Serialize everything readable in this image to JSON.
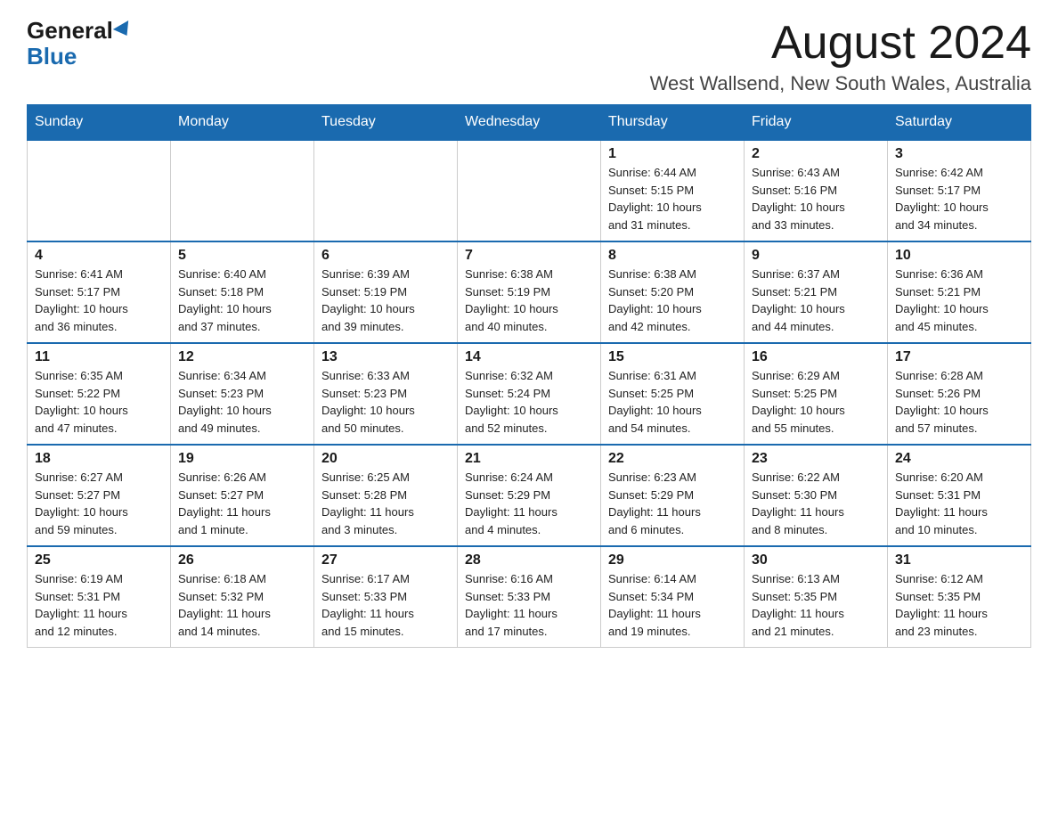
{
  "header": {
    "logo_general": "General",
    "logo_blue": "Blue",
    "month_title": "August 2024",
    "location": "West Wallsend, New South Wales, Australia"
  },
  "days_of_week": [
    "Sunday",
    "Monday",
    "Tuesday",
    "Wednesday",
    "Thursday",
    "Friday",
    "Saturday"
  ],
  "weeks": [
    [
      {
        "day": "",
        "info": ""
      },
      {
        "day": "",
        "info": ""
      },
      {
        "day": "",
        "info": ""
      },
      {
        "day": "",
        "info": ""
      },
      {
        "day": "1",
        "info": "Sunrise: 6:44 AM\nSunset: 5:15 PM\nDaylight: 10 hours\nand 31 minutes."
      },
      {
        "day": "2",
        "info": "Sunrise: 6:43 AM\nSunset: 5:16 PM\nDaylight: 10 hours\nand 33 minutes."
      },
      {
        "day": "3",
        "info": "Sunrise: 6:42 AM\nSunset: 5:17 PM\nDaylight: 10 hours\nand 34 minutes."
      }
    ],
    [
      {
        "day": "4",
        "info": "Sunrise: 6:41 AM\nSunset: 5:17 PM\nDaylight: 10 hours\nand 36 minutes."
      },
      {
        "day": "5",
        "info": "Sunrise: 6:40 AM\nSunset: 5:18 PM\nDaylight: 10 hours\nand 37 minutes."
      },
      {
        "day": "6",
        "info": "Sunrise: 6:39 AM\nSunset: 5:19 PM\nDaylight: 10 hours\nand 39 minutes."
      },
      {
        "day": "7",
        "info": "Sunrise: 6:38 AM\nSunset: 5:19 PM\nDaylight: 10 hours\nand 40 minutes."
      },
      {
        "day": "8",
        "info": "Sunrise: 6:38 AM\nSunset: 5:20 PM\nDaylight: 10 hours\nand 42 minutes."
      },
      {
        "day": "9",
        "info": "Sunrise: 6:37 AM\nSunset: 5:21 PM\nDaylight: 10 hours\nand 44 minutes."
      },
      {
        "day": "10",
        "info": "Sunrise: 6:36 AM\nSunset: 5:21 PM\nDaylight: 10 hours\nand 45 minutes."
      }
    ],
    [
      {
        "day": "11",
        "info": "Sunrise: 6:35 AM\nSunset: 5:22 PM\nDaylight: 10 hours\nand 47 minutes."
      },
      {
        "day": "12",
        "info": "Sunrise: 6:34 AM\nSunset: 5:23 PM\nDaylight: 10 hours\nand 49 minutes."
      },
      {
        "day": "13",
        "info": "Sunrise: 6:33 AM\nSunset: 5:23 PM\nDaylight: 10 hours\nand 50 minutes."
      },
      {
        "day": "14",
        "info": "Sunrise: 6:32 AM\nSunset: 5:24 PM\nDaylight: 10 hours\nand 52 minutes."
      },
      {
        "day": "15",
        "info": "Sunrise: 6:31 AM\nSunset: 5:25 PM\nDaylight: 10 hours\nand 54 minutes."
      },
      {
        "day": "16",
        "info": "Sunrise: 6:29 AM\nSunset: 5:25 PM\nDaylight: 10 hours\nand 55 minutes."
      },
      {
        "day": "17",
        "info": "Sunrise: 6:28 AM\nSunset: 5:26 PM\nDaylight: 10 hours\nand 57 minutes."
      }
    ],
    [
      {
        "day": "18",
        "info": "Sunrise: 6:27 AM\nSunset: 5:27 PM\nDaylight: 10 hours\nand 59 minutes."
      },
      {
        "day": "19",
        "info": "Sunrise: 6:26 AM\nSunset: 5:27 PM\nDaylight: 11 hours\nand 1 minute."
      },
      {
        "day": "20",
        "info": "Sunrise: 6:25 AM\nSunset: 5:28 PM\nDaylight: 11 hours\nand 3 minutes."
      },
      {
        "day": "21",
        "info": "Sunrise: 6:24 AM\nSunset: 5:29 PM\nDaylight: 11 hours\nand 4 minutes."
      },
      {
        "day": "22",
        "info": "Sunrise: 6:23 AM\nSunset: 5:29 PM\nDaylight: 11 hours\nand 6 minutes."
      },
      {
        "day": "23",
        "info": "Sunrise: 6:22 AM\nSunset: 5:30 PM\nDaylight: 11 hours\nand 8 minutes."
      },
      {
        "day": "24",
        "info": "Sunrise: 6:20 AM\nSunset: 5:31 PM\nDaylight: 11 hours\nand 10 minutes."
      }
    ],
    [
      {
        "day": "25",
        "info": "Sunrise: 6:19 AM\nSunset: 5:31 PM\nDaylight: 11 hours\nand 12 minutes."
      },
      {
        "day": "26",
        "info": "Sunrise: 6:18 AM\nSunset: 5:32 PM\nDaylight: 11 hours\nand 14 minutes."
      },
      {
        "day": "27",
        "info": "Sunrise: 6:17 AM\nSunset: 5:33 PM\nDaylight: 11 hours\nand 15 minutes."
      },
      {
        "day": "28",
        "info": "Sunrise: 6:16 AM\nSunset: 5:33 PM\nDaylight: 11 hours\nand 17 minutes."
      },
      {
        "day": "29",
        "info": "Sunrise: 6:14 AM\nSunset: 5:34 PM\nDaylight: 11 hours\nand 19 minutes."
      },
      {
        "day": "30",
        "info": "Sunrise: 6:13 AM\nSunset: 5:35 PM\nDaylight: 11 hours\nand 21 minutes."
      },
      {
        "day": "31",
        "info": "Sunrise: 6:12 AM\nSunset: 5:35 PM\nDaylight: 11 hours\nand 23 minutes."
      }
    ]
  ]
}
